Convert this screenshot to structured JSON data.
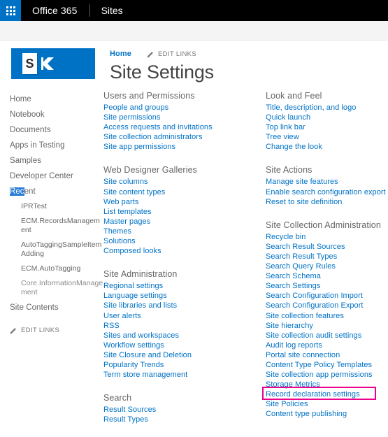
{
  "suitebar": {
    "waffle_icon": "app-launcher-waffle-icon",
    "brand": "Office 365",
    "link": "Sites"
  },
  "header": {
    "logo_letter": "S",
    "logo_icon": "sharepoint-logo",
    "breadcrumb_home": "Home",
    "edit_links": "EDIT LINKS",
    "pencil_icon": "pencil-icon",
    "title": "Site Settings"
  },
  "quicklaunch": {
    "items": [
      {
        "label": "Home",
        "type": "top"
      },
      {
        "label": "Notebook",
        "type": "top"
      },
      {
        "label": "Documents",
        "type": "top"
      },
      {
        "label": "Apps in Testing",
        "type": "top"
      },
      {
        "label": "Samples",
        "type": "top"
      },
      {
        "label": "Developer Center",
        "type": "top"
      },
      {
        "label": "Recent",
        "type": "top",
        "selected_prefix": "Rec",
        "selected_rest": "ent"
      },
      {
        "label": "IPRTest",
        "type": "sub"
      },
      {
        "label": "ECM.RecordsManagement",
        "type": "sub"
      },
      {
        "label": "AutoTaggingSampleItemAdding",
        "type": "sub"
      },
      {
        "label": "ECM.AutoTagging",
        "type": "sub"
      },
      {
        "label": "Core.InformationManagement",
        "type": "sub",
        "faint": true
      },
      {
        "label": "Site Contents",
        "type": "top"
      }
    ],
    "edit_links": "EDIT LINKS"
  },
  "settings": {
    "middle_column": [
      {
        "title": "Users and Permissions",
        "links": [
          "People and groups",
          "Site permissions",
          "Access requests and invitations",
          "Site collection administrators",
          "Site app permissions"
        ]
      },
      {
        "title": "Web Designer Galleries",
        "links": [
          "Site columns",
          "Site content types",
          "Web parts",
          "List templates",
          "Master pages",
          "Themes",
          "Solutions",
          "Composed looks"
        ]
      },
      {
        "title": "Site Administration",
        "links": [
          "Regional settings",
          "Language settings",
          "Site libraries and lists",
          "User alerts",
          "RSS",
          "Sites and workspaces",
          "Workflow settings",
          "Site Closure and Deletion",
          "Popularity Trends",
          "Term store management"
        ]
      },
      {
        "title": "Search",
        "links": [
          "Result Sources",
          "Result Types"
        ]
      }
    ],
    "right_column": [
      {
        "title": "Look and Feel",
        "links": [
          "Title, description, and logo",
          "Quick launch",
          "Top link bar",
          "Tree view",
          "Change the look"
        ]
      },
      {
        "title": "Site Actions",
        "links": [
          "Manage site features",
          "Enable search configuration export",
          "Reset to site definition"
        ]
      },
      {
        "title": "Site Collection Administration",
        "links": [
          "Recycle bin",
          "Search Result Sources",
          "Search Result Types",
          "Search Query Rules",
          "Search Schema",
          "Search Settings",
          "Search Configuration Import",
          "Search Configuration Export",
          "Site collection features",
          "Site hierarchy",
          "Site collection audit settings",
          "Audit log reports",
          "Portal site connection",
          "Content Type Policy Templates",
          "Site collection app permissions",
          "Storage Metrics",
          "Record declaration settings",
          "Site Policies",
          "Content type publishing"
        ],
        "highlighted_link": "Record declaration settings"
      }
    ]
  },
  "colors": {
    "accent_blue": "#0072c6",
    "suitebar_black": "#000000",
    "highlight_pink": "#ec008c",
    "selection_blue": "#2a7cd4",
    "section_gray": "#666666"
  }
}
